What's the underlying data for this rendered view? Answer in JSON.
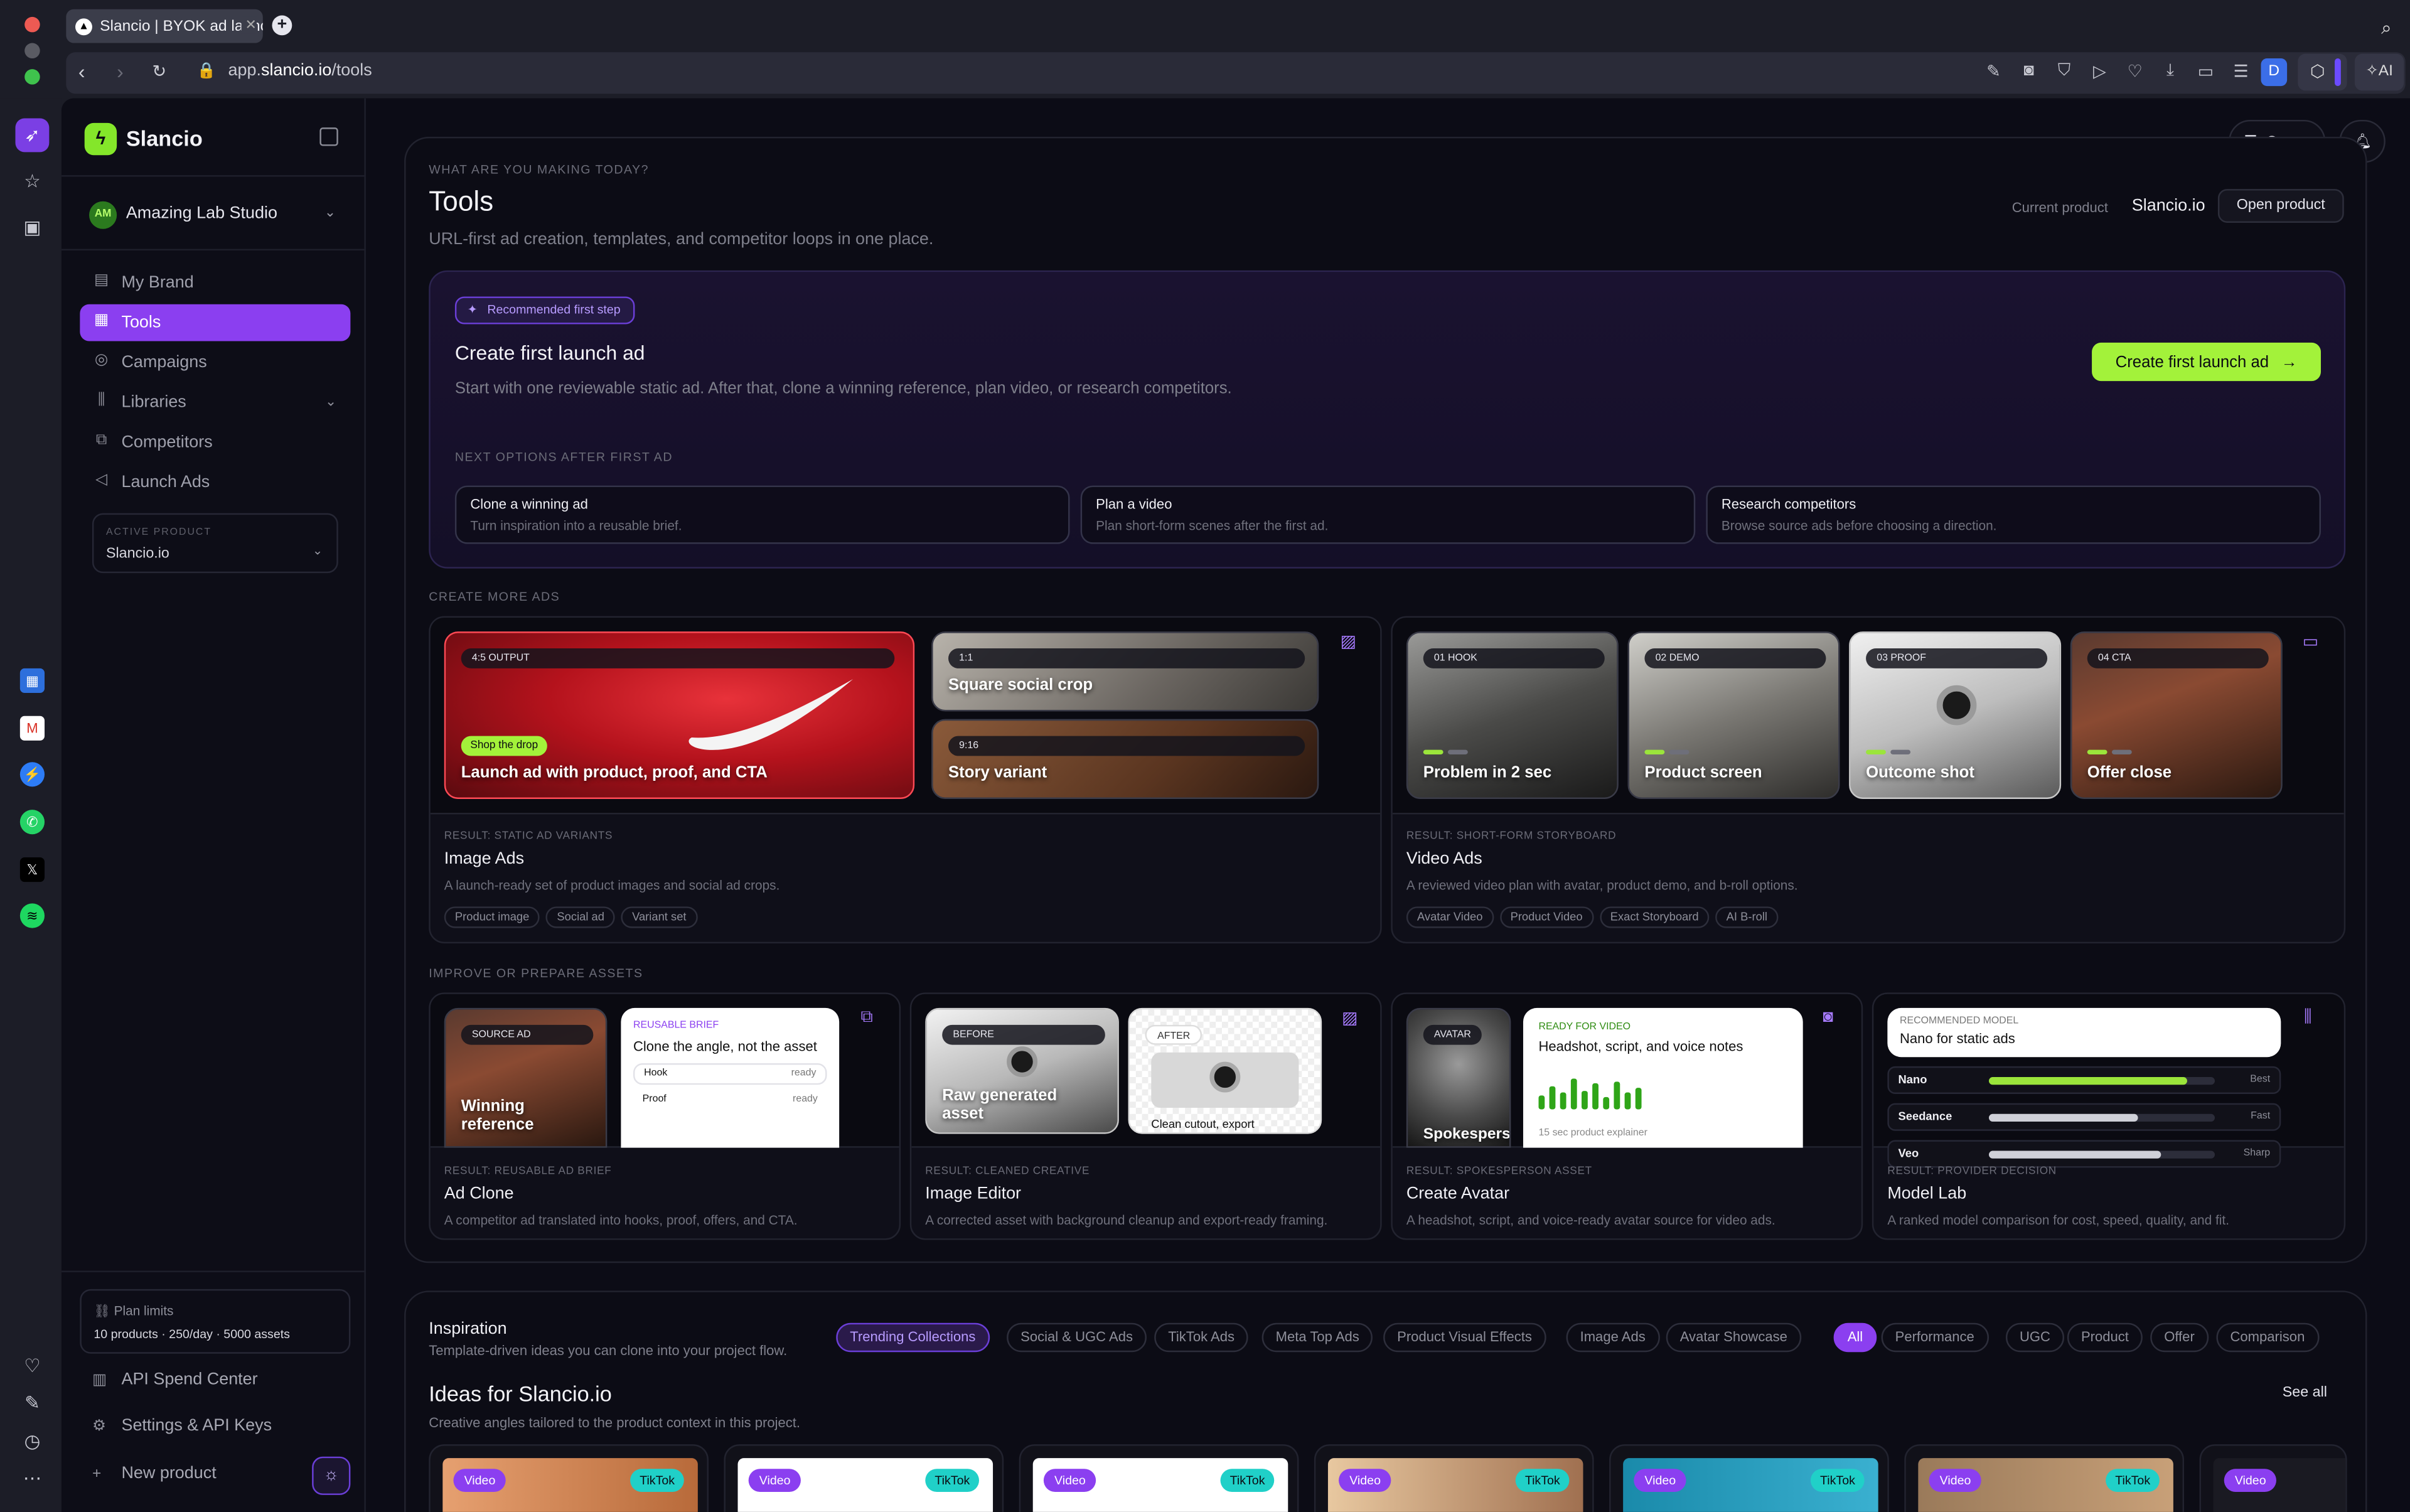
{
  "browser": {
    "tab_title": "Slancio | BYOK ad launch",
    "url_prefix": "app.",
    "url_domain": "slancio.io",
    "url_path": "/tools",
    "profile_initial": "D",
    "ai_label": "AI"
  },
  "sidebar": {
    "brand": "Slancio",
    "workspace": {
      "initials": "AM",
      "name": "Amazing Lab Studio"
    },
    "nav": [
      {
        "label": "My Brand",
        "icon": "brand-icon"
      },
      {
        "label": "Tools",
        "icon": "grid-icon",
        "active": true
      },
      {
        "label": "Campaigns",
        "icon": "target-icon"
      },
      {
        "label": "Libraries",
        "icon": "library-icon"
      },
      {
        "label": "Competitors",
        "icon": "compare-icon"
      },
      {
        "label": "Launch Ads",
        "icon": "megaphone-icon"
      }
    ],
    "active_product": {
      "label": "ACTIVE PRODUCT",
      "value": "Slancio.io"
    },
    "plan": {
      "title": "Plan limits",
      "text": "10 products · 250/day · 5000 assets"
    },
    "bottom_links": [
      {
        "label": "API Spend Center",
        "icon": "chart-icon"
      },
      {
        "label": "Settings & API Keys",
        "icon": "gear-icon"
      },
      {
        "label": "New product",
        "icon": "plus-icon"
      }
    ]
  },
  "header": {
    "queue_label": "Queue"
  },
  "tools": {
    "eyebrow": "WHAT ARE YOU MAKING TODAY?",
    "title": "Tools",
    "subtitle": "URL-first ad creation, templates, and competitor loops in one place.",
    "current_product_label": "Current product",
    "current_product_value": "Slancio.io",
    "open_product_label": "Open product"
  },
  "hero": {
    "pill": "Recommended first step",
    "title": "Create first launch ad",
    "description": "Start with one reviewable static ad. After that, clone a winning reference, plan video, or research competitors.",
    "next_label": "NEXT OPTIONS AFTER FIRST AD",
    "cta_label": "Create first launch ad",
    "options": [
      {
        "title": "Clone a winning ad",
        "desc": "Turn inspiration into a reusable brief."
      },
      {
        "title": "Plan a video",
        "desc": "Plan short-form scenes after the first ad."
      },
      {
        "title": "Research competitors",
        "desc": "Browse source ads before choosing a direction."
      }
    ]
  },
  "create_more": {
    "label": "CREATE MORE ADS",
    "image_ads": {
      "big_pill": "4:5 OUTPUT",
      "badge": "Shop the drop",
      "big_label": "Launch ad with product, proof, and CTA",
      "sq_pill": "1:1",
      "sq_label": "Square social crop",
      "story_pill": "9:16",
      "story_label": "Story variant",
      "result": "RESULT: STATIC AD VARIANTS",
      "title": "Image Ads",
      "desc": "A launch-ready set of product images and social ad crops.",
      "chips": [
        "Product image",
        "Social ad",
        "Variant set"
      ]
    },
    "video_ads": {
      "frames": [
        {
          "pill": "01 HOOK",
          "label": "Problem in 2 sec"
        },
        {
          "pill": "02 DEMO",
          "label": "Product screen"
        },
        {
          "pill": "03 PROOF",
          "label": "Outcome shot"
        },
        {
          "pill": "04 CTA",
          "label": "Offer close"
        }
      ],
      "result": "RESULT: SHORT-FORM STORYBOARD",
      "title": "Video Ads",
      "desc": "A reviewed video plan with avatar, product demo, and b-roll options.",
      "chips": [
        "Avatar Video",
        "Product Video",
        "Exact Storyboard",
        "AI B-roll"
      ]
    }
  },
  "improve": {
    "label": "IMPROVE OR PREPARE ASSETS",
    "ad_clone": {
      "src_pill": "SOURCE AD",
      "src_label": "Winning reference",
      "brief_tag": "REUSABLE BRIEF",
      "brief_title": "Clone the angle, not the asset",
      "rows": [
        {
          "k": "Hook",
          "v": "ready"
        },
        {
          "k": "Proof",
          "v": "ready"
        }
      ],
      "result": "RESULT: REUSABLE AD BRIEF",
      "title": "Ad Clone",
      "desc": "A competitor ad translated into hooks, proof, offers, and CTA."
    },
    "image_editor": {
      "before_pill": "BEFORE",
      "before_label": "Raw generated asset",
      "after_pill": "AFTER",
      "after_label": "Clean cutout, export",
      "result": "RESULT: CLEANED CREATIVE",
      "title": "Image Editor",
      "desc": "A corrected asset with background cleanup and export-ready framing."
    },
    "avatar": {
      "pill": "AVATAR",
      "label": "Spokesperson source",
      "ready": "READY FOR VIDEO",
      "ready_title": "Headshot, script, and voice notes",
      "ready_sub": "15 sec product explainer",
      "wave": [
        0.45,
        0.75,
        0.55,
        1.0,
        0.6,
        0.85,
        0.4,
        0.9,
        0.55,
        0.7
      ],
      "result": "RESULT: SPOKESPERSON ASSET",
      "title": "Create Avatar",
      "desc": "A headshot, script, and voice-ready avatar source for video ads."
    },
    "model_lab": {
      "rec": "RECOMMENDED MODEL",
      "rec_value": "Nano for static ads",
      "models": [
        {
          "name": "Nano",
          "score": 0.88,
          "tag": "Best",
          "color": "#9be53b"
        },
        {
          "name": "Seedance",
          "score": 0.66,
          "tag": "Fast",
          "color": "#cfd0d8"
        },
        {
          "name": "Veo",
          "score": 0.76,
          "tag": "Sharp",
          "color": "#cfd0d8"
        }
      ],
      "result": "RESULT: PROVIDER DECISION",
      "title": "Model Lab",
      "desc": "A ranked model comparison for cost, speed, quality, and fit."
    }
  },
  "inspiration": {
    "title": "Inspiration",
    "subtitle": "Template-driven ideas you can clone into your project flow.",
    "collections": [
      "Trending Collections",
      "Social & UGC Ads",
      "TikTok Ads",
      "Meta Top Ads",
      "Product Visual Effects",
      "Image Ads",
      "Avatar Showcase"
    ],
    "filters": [
      "All",
      "Performance",
      "UGC",
      "Product",
      "Offer",
      "Comparison"
    ],
    "ideas_title": "Ideas for Slancio.io",
    "ideas_sub": "Creative angles tailored to the product context in this project.",
    "see_all": "See all",
    "cards": [
      {
        "type": "Video",
        "platform": "TikTok"
      },
      {
        "type": "Video",
        "platform": "TikTok"
      },
      {
        "type": "Video",
        "platform": "TikTok"
      },
      {
        "type": "Video",
        "platform": "TikTok"
      },
      {
        "type": "Video",
        "platform": "TikTok"
      },
      {
        "type": "Video",
        "platform": "TikTok"
      },
      {
        "type": "Video",
        "platform": ""
      }
    ]
  }
}
